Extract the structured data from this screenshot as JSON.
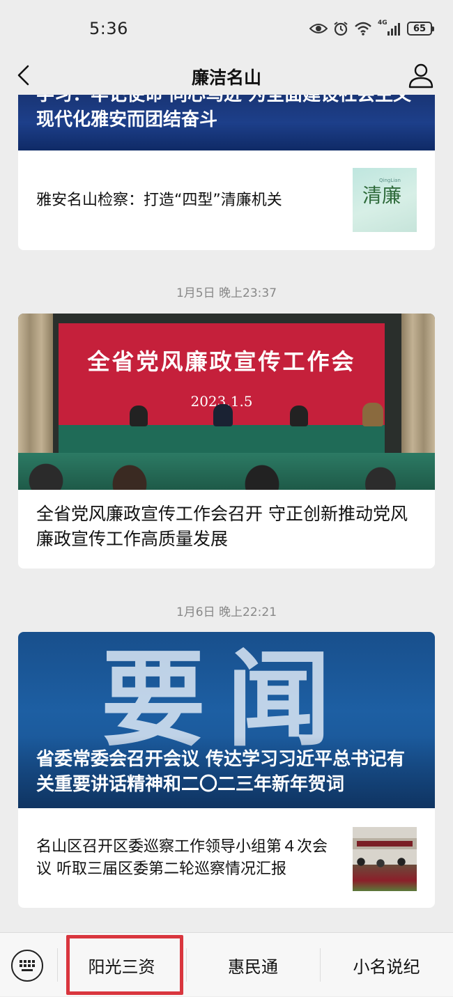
{
  "status_bar": {
    "time": "5:36",
    "network": "4G",
    "battery": "65",
    "icons": [
      "eye-icon",
      "alarm-icon",
      "wifi-icon",
      "signal-icon",
      "battery-icon"
    ]
  },
  "header": {
    "title": "廉洁名山",
    "back_icon": "chevron-left-icon",
    "profile_icon": "user-icon"
  },
  "feed": {
    "group1": {
      "banner_text": "学习：牢记使命 同心笃进 为全面建设社会主义现代化雅安而团结奋斗",
      "sub_article": {
        "title": "雅安名山检察：打造“四型”清廉机关",
        "thumb_text": "清廉",
        "thumb_sub": "QingLian"
      }
    },
    "group2": {
      "timestamp": "1月5日 晚上23:37",
      "image_text": "全省党风廉政宣传工作会",
      "image_date": "2023.1.5",
      "title": "全省党风廉政宣传工作会召开 守正创新推动党风廉政宣传工作高质量发展"
    },
    "group3": {
      "timestamp": "1月6日 晚上22:21",
      "image_big_text": "要闻",
      "banner_title": "省委常委会召开会议 传达学习习近平总书记有关重要讲话精神和二〇二三年新年贺词",
      "sub_article": {
        "title": "名山区召开区委巡察工作领导小组第４次会议 听取三届区委第二轮巡察情况汇报"
      }
    }
  },
  "bottom_menu": {
    "keyboard_icon": "keyboard-icon",
    "items": [
      "阳光三资",
      "惠民通",
      "小名说纪"
    ]
  },
  "colors": {
    "background": "#ededed",
    "highlight": "#d9363e",
    "banner_blue": "#1b3a7a"
  }
}
